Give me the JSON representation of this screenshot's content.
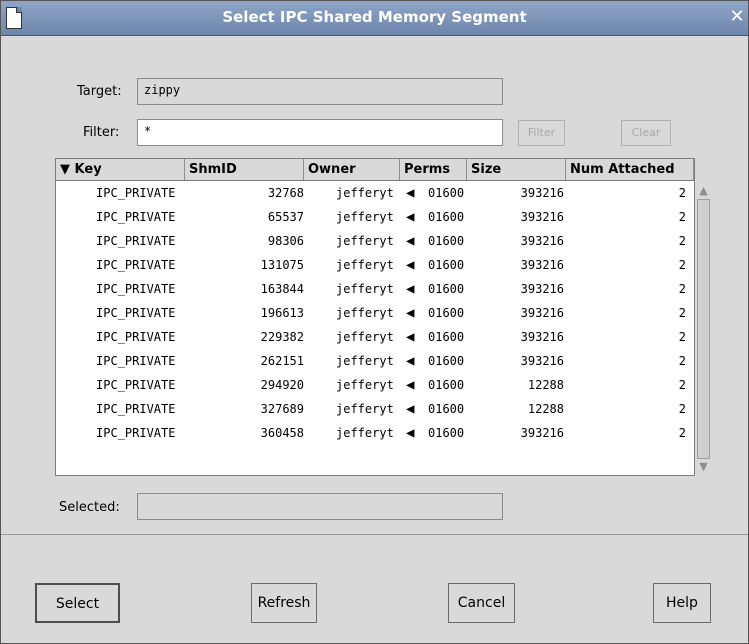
{
  "window": {
    "title": "Select IPC Shared Memory Segment"
  },
  "target": {
    "label": "Target:",
    "value": "zippy"
  },
  "filter": {
    "label": "Filter:",
    "value": "*",
    "filter_button": "Filter",
    "clear_button": "Clear"
  },
  "table": {
    "headers": {
      "key": "Key",
      "shmid": "ShmID",
      "owner": "Owner",
      "perms": "Perms",
      "size": "Size",
      "num_attached": "Num Attached"
    },
    "sort_indicator": "▼",
    "rows": [
      {
        "key": "IPC_PRIVATE",
        "shmid": "32768",
        "owner": "jefferyt",
        "perms": "01600",
        "size": "393216",
        "num_attached": "2"
      },
      {
        "key": "IPC_PRIVATE",
        "shmid": "65537",
        "owner": "jefferyt",
        "perms": "01600",
        "size": "393216",
        "num_attached": "2"
      },
      {
        "key": "IPC_PRIVATE",
        "shmid": "98306",
        "owner": "jefferyt",
        "perms": "01600",
        "size": "393216",
        "num_attached": "2"
      },
      {
        "key": "IPC_PRIVATE",
        "shmid": "131075",
        "owner": "jefferyt",
        "perms": "01600",
        "size": "393216",
        "num_attached": "2"
      },
      {
        "key": "IPC_PRIVATE",
        "shmid": "163844",
        "owner": "jefferyt",
        "perms": "01600",
        "size": "393216",
        "num_attached": "2"
      },
      {
        "key": "IPC_PRIVATE",
        "shmid": "196613",
        "owner": "jefferyt",
        "perms": "01600",
        "size": "393216",
        "num_attached": "2"
      },
      {
        "key": "IPC_PRIVATE",
        "shmid": "229382",
        "owner": "jefferyt",
        "perms": "01600",
        "size": "393216",
        "num_attached": "2"
      },
      {
        "key": "IPC_PRIVATE",
        "shmid": "262151",
        "owner": "jefferyt",
        "perms": "01600",
        "size": "393216",
        "num_attached": "2"
      },
      {
        "key": "IPC_PRIVATE",
        "shmid": "294920",
        "owner": "jefferyt",
        "perms": "01600",
        "size": "12288",
        "num_attached": "2"
      },
      {
        "key": "IPC_PRIVATE",
        "shmid": "327689",
        "owner": "jefferyt",
        "perms": "01600",
        "size": "12288",
        "num_attached": "2"
      },
      {
        "key": "IPC_PRIVATE",
        "shmid": "360458",
        "owner": "jefferyt",
        "perms": "01600",
        "size": "393216",
        "num_attached": "2"
      }
    ]
  },
  "selected": {
    "label": "Selected:",
    "value": ""
  },
  "buttons": {
    "select": "Select",
    "refresh": "Refresh",
    "cancel": "Cancel",
    "help": "Help"
  }
}
